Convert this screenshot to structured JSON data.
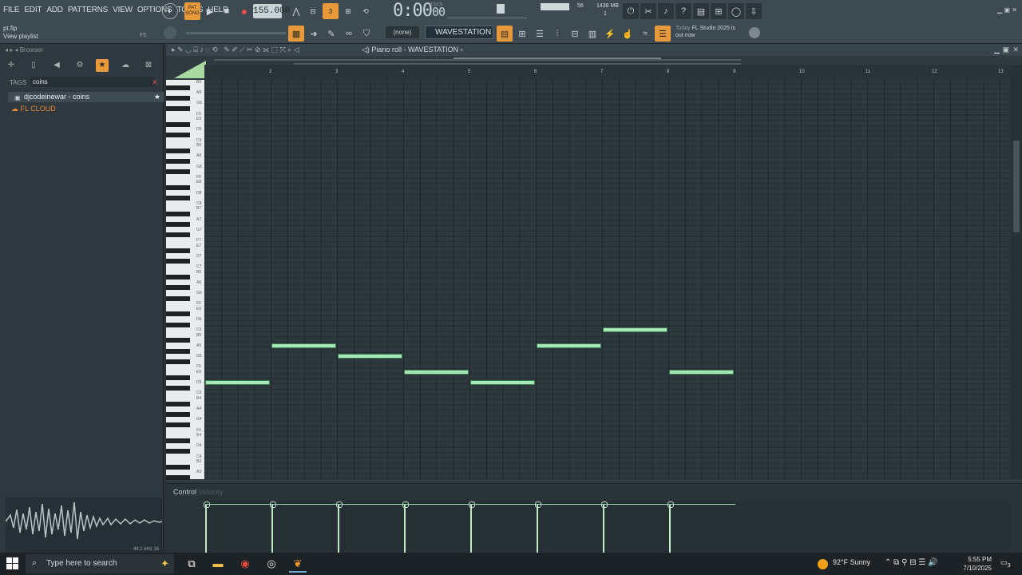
{
  "menu": [
    "FILE",
    "EDIT",
    "ADD",
    "PATTERNS",
    "VIEW",
    "OPTIONS",
    "TOOLS",
    "HELP"
  ],
  "transport": {
    "pat_label": "PAT",
    "song_label": "SONG",
    "tempo": "155.000",
    "time": "0:00",
    "time_small": "00",
    "time_unit": "M:S:CS"
  },
  "cpu": {
    "value1": "56",
    "memory": "1438 MB",
    "value2": "1"
  },
  "hint": {
    "file": "pt.flp",
    "action": "View playlist",
    "key": "F5"
  },
  "pattern_selector": "(none)",
  "channel": "WAVESTATION",
  "news": {
    "line1_prefix": "Today",
    "line1": "FL Studio 2025 is",
    "line2": "out now"
  },
  "browser": {
    "title": "Browser",
    "tags_label": "TAGS",
    "search_value": "coins",
    "items": [
      {
        "label": "djcodeinewar - coins"
      },
      {
        "label": "FL CLOUD"
      }
    ],
    "sample_info": "44.1 kHz 16"
  },
  "piano_roll": {
    "title": "Piano roll - WAVESTATION",
    "control_label": "Control",
    "control_target": "Velocity",
    "bars": [
      "2",
      "3",
      "4",
      "5",
      "6",
      "7",
      "8",
      "9",
      "10",
      "11",
      "12",
      "13"
    ],
    "key_labels": [
      "B9",
      "A9",
      "G9",
      "F9",
      "E9",
      "D9",
      "C9",
      "B8",
      "A8",
      "G8",
      "F8",
      "E8",
      "D8",
      "C8",
      "B7",
      "A7",
      "G7",
      "F7",
      "E7",
      "D7",
      "C7",
      "B6",
      "A6",
      "G6",
      "F6",
      "E6",
      "D6",
      "C6",
      "B5",
      "A5",
      "G5",
      "F5",
      "E5",
      "D5",
      "C5",
      "B4",
      "A4",
      "G4",
      "F4",
      "E4",
      "D4",
      "C4",
      "B3",
      "A3"
    ],
    "notes": [
      {
        "pitch": "D5",
        "bar": 1
      },
      {
        "pitch": "A5",
        "bar": 2
      },
      {
        "pitch": "G5",
        "bar": 3
      },
      {
        "pitch": "E5",
        "bar": 4
      },
      {
        "pitch": "D5",
        "bar": 5
      },
      {
        "pitch": "A5",
        "bar": 6
      },
      {
        "pitch": "C6",
        "bar": 7
      },
      {
        "pitch": "E5",
        "bar": 8
      }
    ]
  },
  "taskbar": {
    "search_placeholder": "Type here to search",
    "weather": "92°F  Sunny",
    "time": "5:55 PM",
    "date": "7/10/2025",
    "notifications": "3"
  }
}
